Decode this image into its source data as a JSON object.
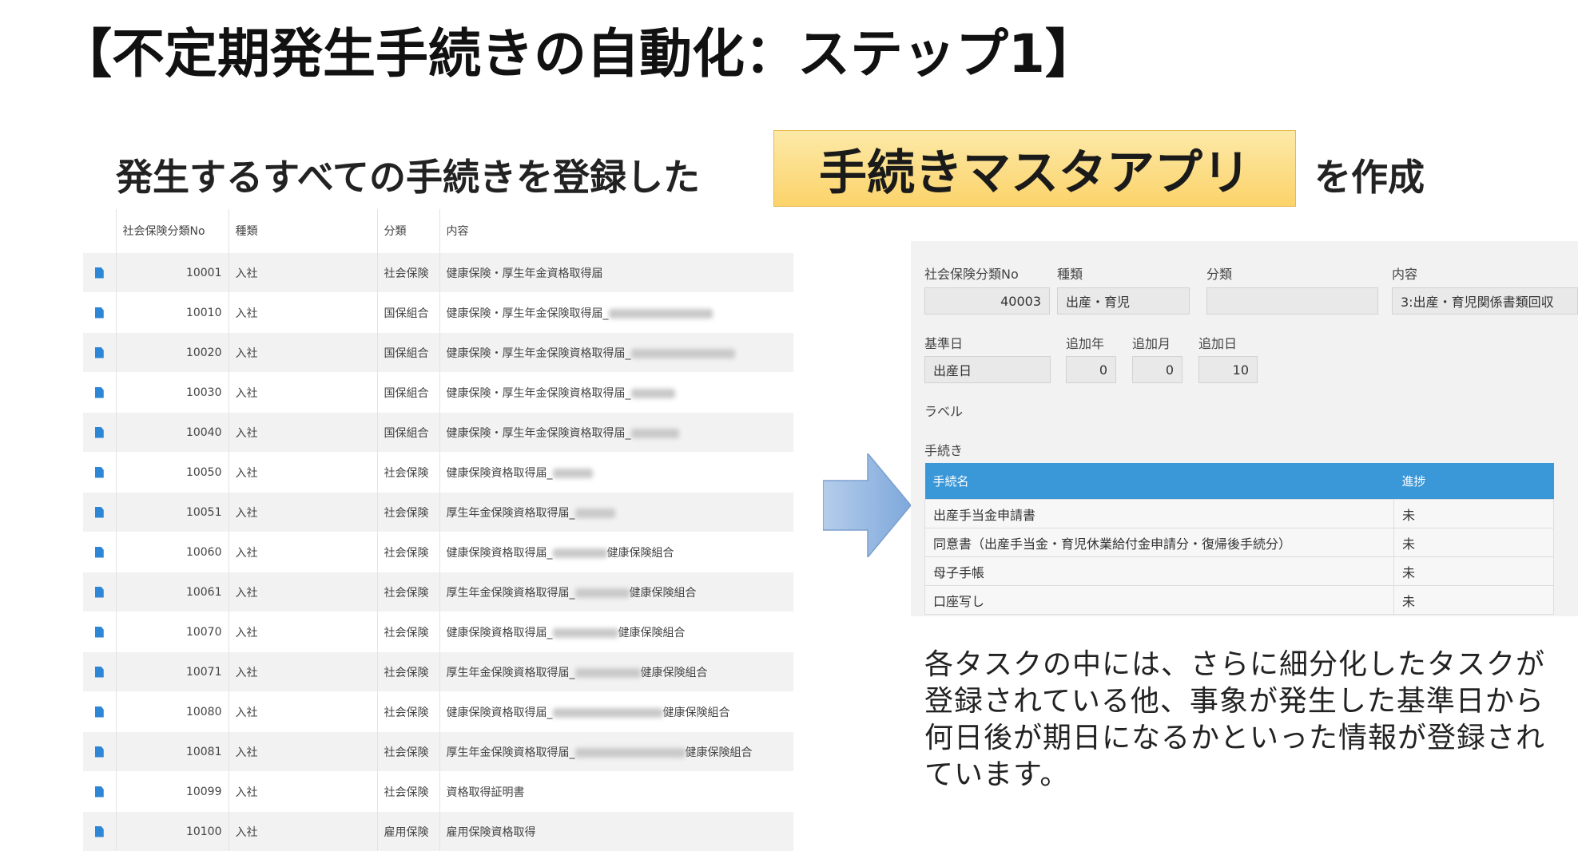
{
  "title": "【不定期発生手続きの自動化：ステップ1】",
  "subtitle": {
    "left": "発生するすべての手続きを登録した",
    "app_name": "手続きマスタアプリ",
    "right": "を作成"
  },
  "list": {
    "headers": [
      "",
      "社会保険分類No",
      "種類",
      "分類",
      "内容"
    ],
    "rows": [
      {
        "no": "10001",
        "type": "入社",
        "category": "社会保険",
        "content": "健康保険・厚生年金資格取得届",
        "blur": 0,
        "suffix": ""
      },
      {
        "no": "10010",
        "type": "入社",
        "category": "国保組合",
        "content": "健康保険・厚生年金保険取得届_",
        "blur": 130,
        "suffix": ""
      },
      {
        "no": "10020",
        "type": "入社",
        "category": "国保組合",
        "content": "健康保険・厚生年金保険資格取得届_",
        "blur": 130,
        "suffix": ""
      },
      {
        "no": "10030",
        "type": "入社",
        "category": "国保組合",
        "content": "健康保険・厚生年金保険資格取得届_",
        "blur": 55,
        "suffix": ""
      },
      {
        "no": "10040",
        "type": "入社",
        "category": "国保組合",
        "content": "健康保険・厚生年金保険資格取得届_",
        "blur": 60,
        "suffix": ""
      },
      {
        "no": "10050",
        "type": "入社",
        "category": "社会保険",
        "content": "健康保険資格取得届_",
        "blur": 50,
        "suffix": ""
      },
      {
        "no": "10051",
        "type": "入社",
        "category": "社会保険",
        "content": "厚生年金保険資格取得届_",
        "blur": 50,
        "suffix": ""
      },
      {
        "no": "10060",
        "type": "入社",
        "category": "社会保険",
        "content": "健康保険資格取得届_",
        "blur": 68,
        "suffix": "健康保険組合"
      },
      {
        "no": "10061",
        "type": "入社",
        "category": "社会保険",
        "content": "厚生年金保険資格取得届_",
        "blur": 68,
        "suffix": "健康保険組合"
      },
      {
        "no": "10070",
        "type": "入社",
        "category": "社会保険",
        "content": "健康保険資格取得届_",
        "blur": 82,
        "suffix": "健康保険組合"
      },
      {
        "no": "10071",
        "type": "入社",
        "category": "社会保険",
        "content": "厚生年金保険資格取得届_",
        "blur": 82,
        "suffix": "健康保険組合"
      },
      {
        "no": "10080",
        "type": "入社",
        "category": "社会保険",
        "content": "健康保険資格取得届_",
        "blur": 138,
        "suffix": "健康保険組合"
      },
      {
        "no": "10081",
        "type": "入社",
        "category": "社会保険",
        "content": "厚生年金保険資格取得届_",
        "blur": 138,
        "suffix": "健康保険組合"
      },
      {
        "no": "10099",
        "type": "入社",
        "category": "社会保険",
        "content": "資格取得証明書",
        "blur": 0,
        "suffix": ""
      },
      {
        "no": "10100",
        "type": "入社",
        "category": "雇用保険",
        "content": "雇用保険資格取得",
        "blur": 0,
        "suffix": ""
      }
    ]
  },
  "form": {
    "labels": {
      "no": "社会保険分類No",
      "type": "種類",
      "category": "分類",
      "content": "内容",
      "base_date": "基準日",
      "add_year": "追加年",
      "add_month": "追加月",
      "add_day": "追加日",
      "label": "ラベル",
      "procedures": "手続き"
    },
    "values": {
      "no": "40003",
      "type": "出産・育児",
      "category": "",
      "content": "3:出産・育児関係書類回収",
      "base_date": "出産日",
      "add_year": "0",
      "add_month": "0",
      "add_day": "10"
    },
    "procedure_headers": [
      "手続名",
      "進捗"
    ],
    "procedures": [
      {
        "name": "出産手当金申請書",
        "status": "未"
      },
      {
        "name": "同意書（出産手当金・育児休業給付金申請分・復帰後手続分）",
        "status": "未"
      },
      {
        "name": "母子手帳",
        "status": "未"
      },
      {
        "name": "口座写し",
        "status": "未"
      }
    ]
  },
  "note": "各タスクの中には、さらに細分化したタスクが登録されている他、事象が発生した基準日から何日後が期日になるかといった情報が登録されています。",
  "colors": {
    "accent_blue": "#3a97d8",
    "highlight_yellow": "#fbd36a",
    "arrow_blue": "#8db4e2"
  }
}
